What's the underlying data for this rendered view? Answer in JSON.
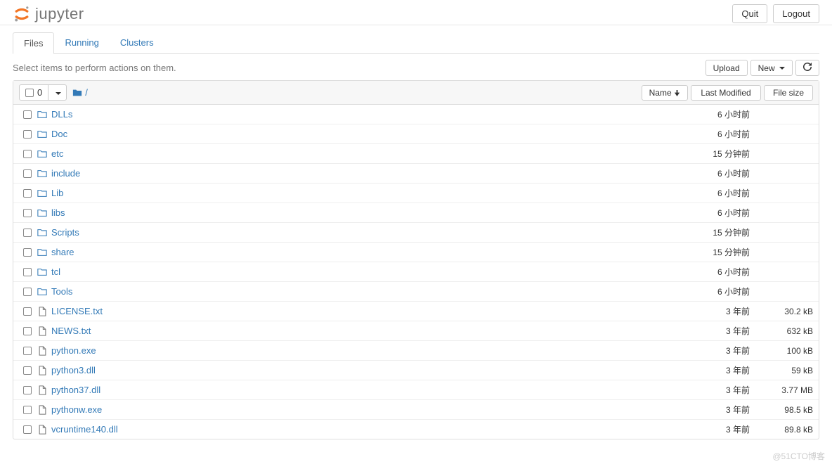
{
  "header": {
    "brand": "jupyter",
    "quit_label": "Quit",
    "logout_label": "Logout"
  },
  "tabs": {
    "files": "Files",
    "running": "Running",
    "clusters": "Clusters"
  },
  "hint": "Select items to perform actions on them.",
  "toolbar": {
    "upload_label": "Upload",
    "new_label": "New",
    "select_count": "0"
  },
  "columns": {
    "name": "Name",
    "modified": "Last Modified",
    "size": "File size"
  },
  "breadcrumb_root": "/",
  "items": [
    {
      "type": "folder",
      "name": "DLLs",
      "modified": "6 小时前",
      "size": ""
    },
    {
      "type": "folder",
      "name": "Doc",
      "modified": "6 小时前",
      "size": ""
    },
    {
      "type": "folder",
      "name": "etc",
      "modified": "15 分钟前",
      "size": ""
    },
    {
      "type": "folder",
      "name": "include",
      "modified": "6 小时前",
      "size": ""
    },
    {
      "type": "folder",
      "name": "Lib",
      "modified": "6 小时前",
      "size": ""
    },
    {
      "type": "folder",
      "name": "libs",
      "modified": "6 小时前",
      "size": ""
    },
    {
      "type": "folder",
      "name": "Scripts",
      "modified": "15 分钟前",
      "size": ""
    },
    {
      "type": "folder",
      "name": "share",
      "modified": "15 分钟前",
      "size": ""
    },
    {
      "type": "folder",
      "name": "tcl",
      "modified": "6 小时前",
      "size": ""
    },
    {
      "type": "folder",
      "name": "Tools",
      "modified": "6 小时前",
      "size": ""
    },
    {
      "type": "file",
      "name": "LICENSE.txt",
      "modified": "3 年前",
      "size": "30.2 kB"
    },
    {
      "type": "file",
      "name": "NEWS.txt",
      "modified": "3 年前",
      "size": "632 kB"
    },
    {
      "type": "file",
      "name": "python.exe",
      "modified": "3 年前",
      "size": "100 kB"
    },
    {
      "type": "file",
      "name": "python3.dll",
      "modified": "3 年前",
      "size": "59 kB"
    },
    {
      "type": "file",
      "name": "python37.dll",
      "modified": "3 年前",
      "size": "3.77 MB"
    },
    {
      "type": "file",
      "name": "pythonw.exe",
      "modified": "3 年前",
      "size": "98.5 kB"
    },
    {
      "type": "file",
      "name": "vcruntime140.dll",
      "modified": "3 年前",
      "size": "89.8 kB"
    }
  ],
  "watermark": "@51CTO博客"
}
